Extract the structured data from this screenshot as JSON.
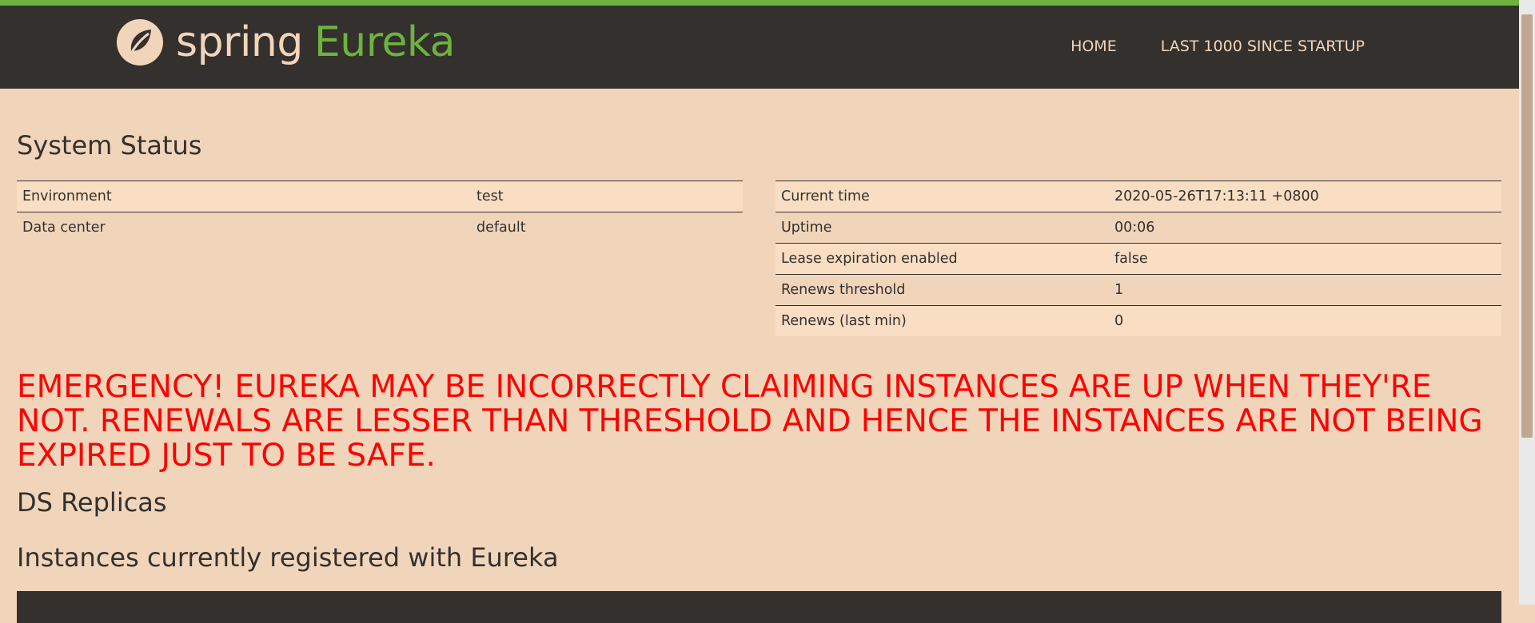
{
  "header": {
    "brand_spring": "spring",
    "brand_eureka": "Eureka",
    "nav": [
      {
        "label": "HOME"
      },
      {
        "label": "LAST 1000 SINCE STARTUP"
      }
    ]
  },
  "system_status": {
    "title": "System Status",
    "left_rows": [
      {
        "label": "Environment",
        "value": "test"
      },
      {
        "label": "Data center",
        "value": "default"
      }
    ],
    "right_rows": [
      {
        "label": "Current time",
        "value": "2020-05-26T17:13:11 +0800"
      },
      {
        "label": "Uptime",
        "value": "00:06"
      },
      {
        "label": "Lease expiration enabled",
        "value": "false"
      },
      {
        "label": "Renews threshold",
        "value": "1"
      },
      {
        "label": "Renews (last min)",
        "value": "0"
      }
    ]
  },
  "emergency_message": "EMERGENCY! EUREKA MAY BE INCORRECTLY CLAIMING INSTANCES ARE UP WHEN THEY'RE NOT. RENEWALS ARE LESSER THAN THRESHOLD AND HENCE THE INSTANCES ARE NOT BEING EXPIRED JUST TO BE SAFE.",
  "ds_replicas_title": "DS Replicas",
  "instances_title": "Instances currently registered with Eureka",
  "colors": {
    "accent_green": "#6db33f",
    "nav_bg": "#34302d",
    "page_bg": "#f1d5bb",
    "warning_red": "#ff0000"
  },
  "icons": {
    "logo": "spring-leaf-icon"
  }
}
